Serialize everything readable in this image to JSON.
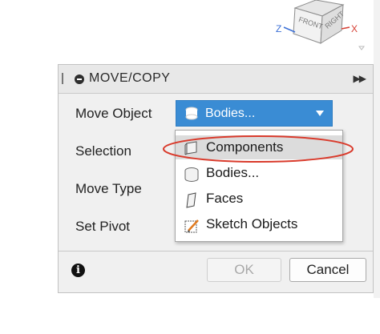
{
  "viewcube": {
    "face_front": "FRONT",
    "face_right": "RIGHT",
    "axis_z": "Z",
    "axis_x": "X"
  },
  "dialog": {
    "title": "MOVE/COPY",
    "rows": [
      {
        "label": "Move Object"
      },
      {
        "label": "Selection"
      },
      {
        "label": "Move Type"
      },
      {
        "label": "Set Pivot"
      }
    ],
    "move_object_value": "Bodies...",
    "ok_label": "OK",
    "cancel_label": "Cancel",
    "info_glyph": "i"
  },
  "dropdown_menu": {
    "items": [
      {
        "label": "Components",
        "icon": "component-icon",
        "highlighted": true
      },
      {
        "label": "Bodies...",
        "icon": "body-icon",
        "highlighted": false
      },
      {
        "label": "Faces",
        "icon": "face-icon",
        "highlighted": false
      },
      {
        "label": "Sketch Objects",
        "icon": "sketch-icon",
        "highlighted": false
      }
    ]
  },
  "colors": {
    "accent_blue": "#3a8cd4",
    "annotation_red": "#d93a2b",
    "highlight_gray": "#dcdcdc"
  }
}
